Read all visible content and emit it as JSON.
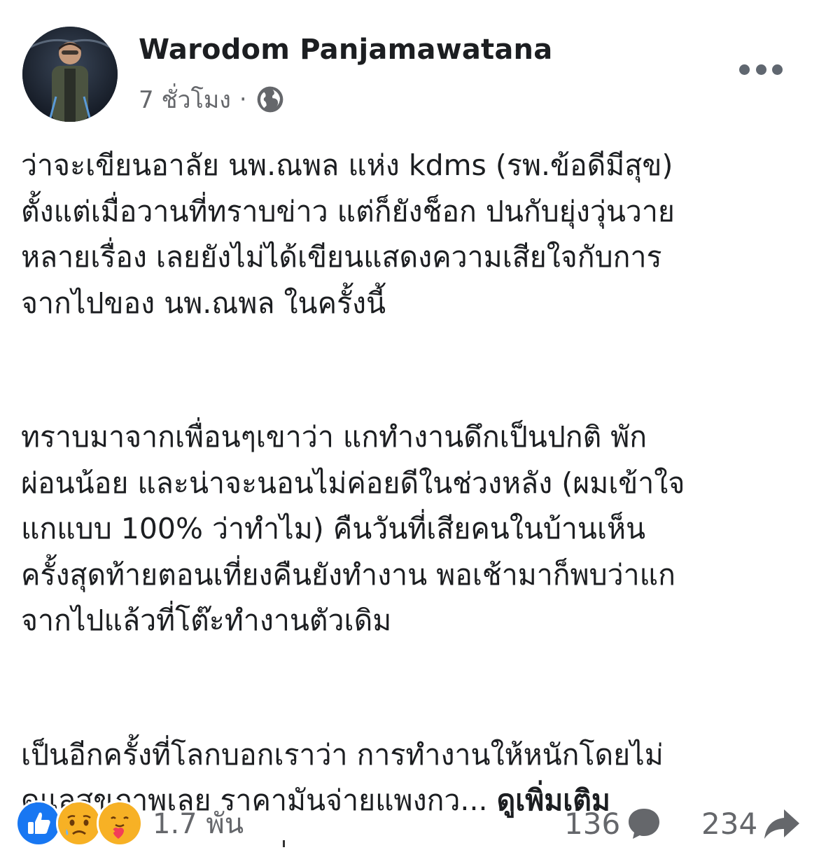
{
  "post": {
    "author": "Warodom Panjamawatana",
    "time": "7 ชั่วโมง",
    "separator": "·",
    "privacy_icon": "globe-icon",
    "more_icon": "more-options-icon"
  },
  "content": {
    "paragraph1": [
      "ว่าจะเขียนอาลัย นพ.ณพล แห่ง kdms (รพ.ข้อดีมีสุข)",
      "ตั้งแต่เมื่อวานที่ทราบข่าว แต่ก็ยังช็อก ปนกับยุ่งวุ่นวาย",
      "หลายเรื่อง เลยยังไม่ได้เขียนแสดงความเสียใจกับการ",
      "จากไปของ นพ.ณพล ในครั้งนี้"
    ],
    "paragraph2": [
      "ทราบมาจากเพื่อนๆเขาว่า แกทำงานดึกเป็นปกติ พัก",
      "ผ่อนน้อย และน่าจะนอนไม่ค่อยดีในช่วงหลัง (ผมเข้าใจ",
      "แกแบบ 100% ว่าทำไม) คืนวันที่เสียคนในบ้านเห็น",
      "ครั้งสุดท้ายตอนเที่ยงคืนยังทำงาน พอเช้ามาก็พบว่าแก",
      "จากไปแล้วที่โต๊ะทำงานตัวเดิม"
    ],
    "paragraph3": [
      "เป็นอีกครั้งที่โลกบอกเราว่า การทำงานให้หนักโดยไม่",
      "ดูแลสุขภาพเลย ราคามันจ่ายแพงกว..."
    ],
    "see_more": "ดูเพิ่มเติม"
  },
  "footer": {
    "reaction_icons": [
      "like-icon",
      "sad-icon",
      "care-icon"
    ],
    "reaction_count": "1.7 พัน",
    "comment_count": "136",
    "share_count": "234",
    "colors": {
      "like": "#1877f2",
      "emoji": "#f7b125",
      "muted": "#65676b"
    }
  }
}
